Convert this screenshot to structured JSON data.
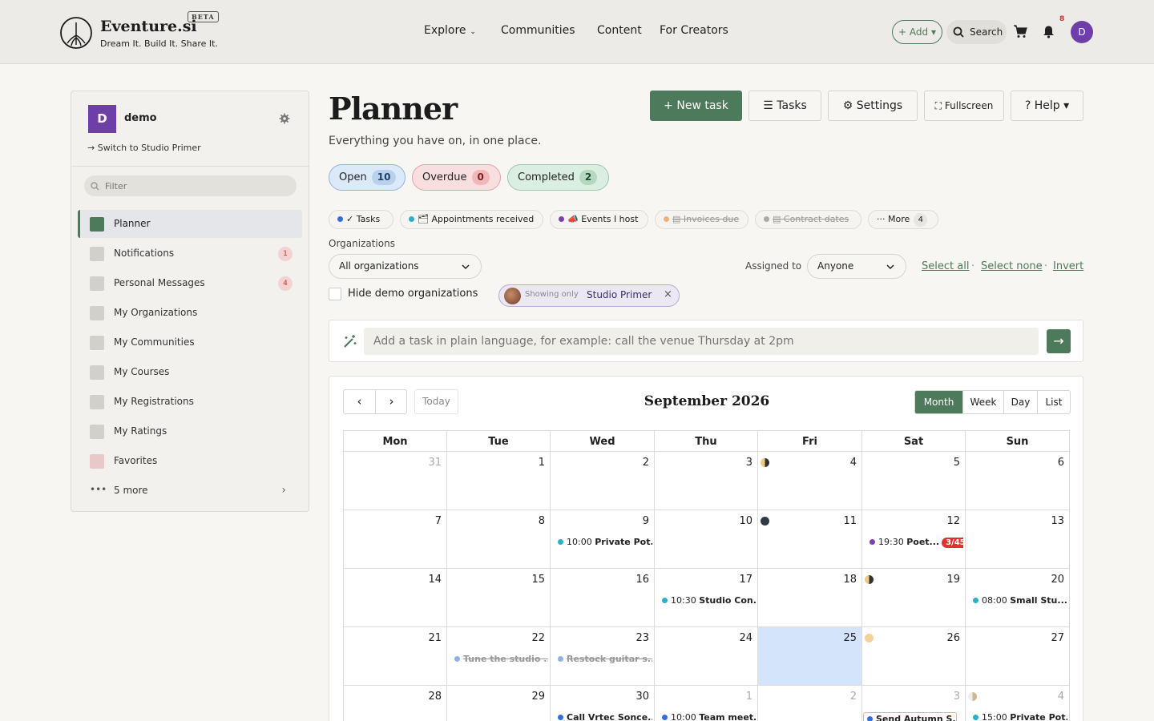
{
  "header": {
    "brand": "Eventure.si",
    "beta": "BETA",
    "tagline": "Dream It. Build It. Share It.",
    "nav": [
      "Explore",
      "Communities",
      "Content",
      "For Creators"
    ],
    "add_label": "+ Add",
    "search_label": "Search",
    "notif_count": "8",
    "avatar_initial": "D"
  },
  "sidebar": {
    "avatar_initial": "D",
    "account_name": "demo",
    "switch_label": "Switch to Studio Primer",
    "filter_placeholder": "Filter",
    "items": [
      {
        "label": "Planner",
        "badge": ""
      },
      {
        "label": "Notifications",
        "badge": "1"
      },
      {
        "label": "Personal Messages",
        "badge": "4"
      },
      {
        "label": "My Organizations",
        "badge": ""
      },
      {
        "label": "My Communities",
        "badge": ""
      },
      {
        "label": "My Courses",
        "badge": ""
      },
      {
        "label": "My Registrations",
        "badge": ""
      },
      {
        "label": "My Ratings",
        "badge": ""
      },
      {
        "label": "Favorites",
        "badge": ""
      },
      {
        "label": "5 more",
        "badge": ""
      }
    ]
  },
  "main": {
    "title": "Planner",
    "subtitle": "Everything you have on, in one place.",
    "buttons": {
      "new_task": "New task",
      "tasks": "Tasks",
      "settings": "Settings",
      "fullscreen": "Fullscreen",
      "help": "Help"
    },
    "status_pills": [
      {
        "label": "Open",
        "count": "10"
      },
      {
        "label": "Overdue",
        "count": "0"
      },
      {
        "label": "Completed",
        "count": "2"
      }
    ],
    "filters": [
      {
        "label": "Tasks",
        "color": "#2f6fe0",
        "on": true
      },
      {
        "label": "Appointments received",
        "color": "#2bb0c9",
        "on": true
      },
      {
        "label": "Events I host",
        "color": "#7b3fb0",
        "on": true
      },
      {
        "label": "Invoices due",
        "color": "#f0b27a",
        "on": false
      },
      {
        "label": "Contract dates",
        "color": "#aaaaaa",
        "on": false
      }
    ],
    "more_label": "More",
    "more_count": "4",
    "organizations_label": "Organizations",
    "organizations_value": "All organizations",
    "assigned_label": "Assigned to",
    "assigned_value": "Anyone",
    "select_all": "Select all",
    "select_none": "Select none",
    "invert": "Invert",
    "hide_demo": "Hide demo organizations",
    "showing_only_prefix": "Showing only",
    "showing_only_org": "Studio Primer",
    "quick_add_placeholder": "Add a task in plain language, for example: call the venue Thursday at 2pm"
  },
  "calendar": {
    "title": "September 2026",
    "today_label": "Today",
    "views": [
      "Month",
      "Week",
      "Day",
      "List"
    ],
    "active_view": "Month",
    "weekdays": [
      "Mon",
      "Tue",
      "Wed",
      "Thu",
      "Fri",
      "Sat",
      "Sun"
    ],
    "weeks": [
      [
        {
          "d": "31",
          "other": true
        },
        {
          "d": "1"
        },
        {
          "d": "2"
        },
        {
          "d": "3"
        },
        {
          "d": "4",
          "moon": "first"
        },
        {
          "d": "5"
        },
        {
          "d": "6"
        }
      ],
      [
        {
          "d": "7"
        },
        {
          "d": "8"
        },
        {
          "d": "9",
          "ev": {
            "time": "10:00",
            "text": "Private Pot...",
            "color": "#2bb0c9"
          }
        },
        {
          "d": "10"
        },
        {
          "d": "11",
          "moon": "new"
        },
        {
          "d": "12",
          "ev": {
            "time": "19:30",
            "text": "Poet...",
            "color": "#7b3fb0",
            "badge": "3/45"
          }
        },
        {
          "d": "13"
        }
      ],
      [
        {
          "d": "14"
        },
        {
          "d": "15"
        },
        {
          "d": "16"
        },
        {
          "d": "17",
          "ev": {
            "time": "10:30",
            "text": "Studio Con...",
            "color": "#2bb0c9"
          }
        },
        {
          "d": "18"
        },
        {
          "d": "19",
          "moon": "first"
        },
        {
          "d": "20",
          "ev": {
            "time": "08:00",
            "text": "Small Stu...",
            "color": "#2bb0c9"
          }
        }
      ],
      [
        {
          "d": "21"
        },
        {
          "d": "22",
          "ev": {
            "time": "",
            "text": "Tune the studio ...",
            "color": "#8fb3e0",
            "done": true
          }
        },
        {
          "d": "23",
          "ev": {
            "time": "",
            "text": "Restock guitar s...",
            "color": "#8fb3e0",
            "done": true
          }
        },
        {
          "d": "24"
        },
        {
          "d": "25",
          "today": true
        },
        {
          "d": "26",
          "moon": "full"
        },
        {
          "d": "27"
        }
      ],
      [
        {
          "d": "28"
        },
        {
          "d": "29"
        },
        {
          "d": "30",
          "ev": {
            "time": "",
            "text": "Call Vrtec Sonce...",
            "color": "#2f6fe0"
          }
        },
        {
          "d": "1",
          "other": true,
          "ev": {
            "time": "10:00",
            "text": "Team meet...",
            "color": "#2f6fe0"
          }
        },
        {
          "d": "2",
          "other": true
        },
        {
          "d": "3",
          "other": true,
          "ev": {
            "time": "",
            "text": "Send Autumn S...",
            "color": "#2f6fe0",
            "boxed": true
          }
        },
        {
          "d": "4",
          "other": true,
          "moon": "last",
          "ev": {
            "time": "15:00",
            "text": "Private Pot...",
            "color": "#2bb0c9"
          }
        }
      ]
    ]
  }
}
